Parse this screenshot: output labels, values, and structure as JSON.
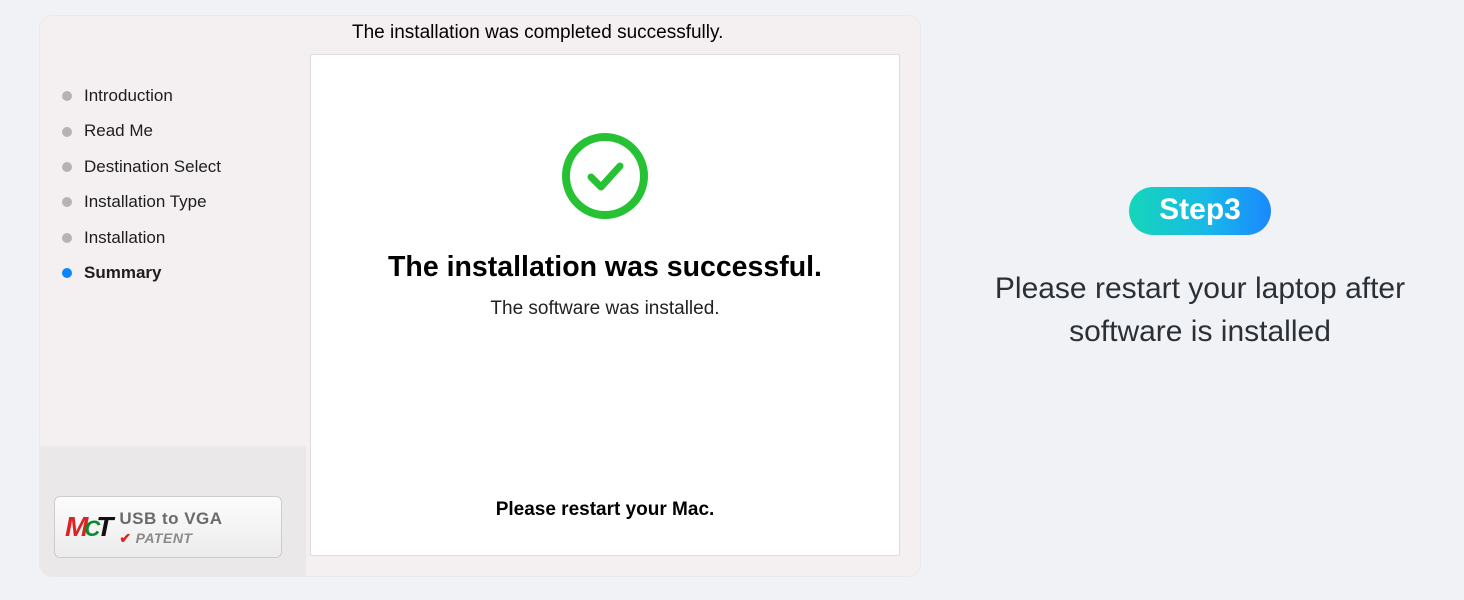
{
  "installer": {
    "status_heading": "The installation was completed successfully.",
    "steps": [
      {
        "label": "Introduction",
        "active": false
      },
      {
        "label": "Read Me",
        "active": false
      },
      {
        "label": "Destination Select",
        "active": false
      },
      {
        "label": "Installation Type",
        "active": false
      },
      {
        "label": "Installation",
        "active": false
      },
      {
        "label": "Summary",
        "active": true
      }
    ],
    "panel": {
      "success_heading": "The installation was successful.",
      "success_sub": "The software was installed.",
      "restart_line": "Please restart your Mac."
    },
    "logo": {
      "brand_m": "M",
      "brand_c": "C",
      "brand_t": "T",
      "line1": "USB to VGA",
      "line2": "PATENT",
      "check": "✔"
    }
  },
  "guide": {
    "badge": "Step3",
    "instruction": "Please restart your laptop after software is installed"
  },
  "icons": {
    "success_check": "success-check-icon"
  }
}
